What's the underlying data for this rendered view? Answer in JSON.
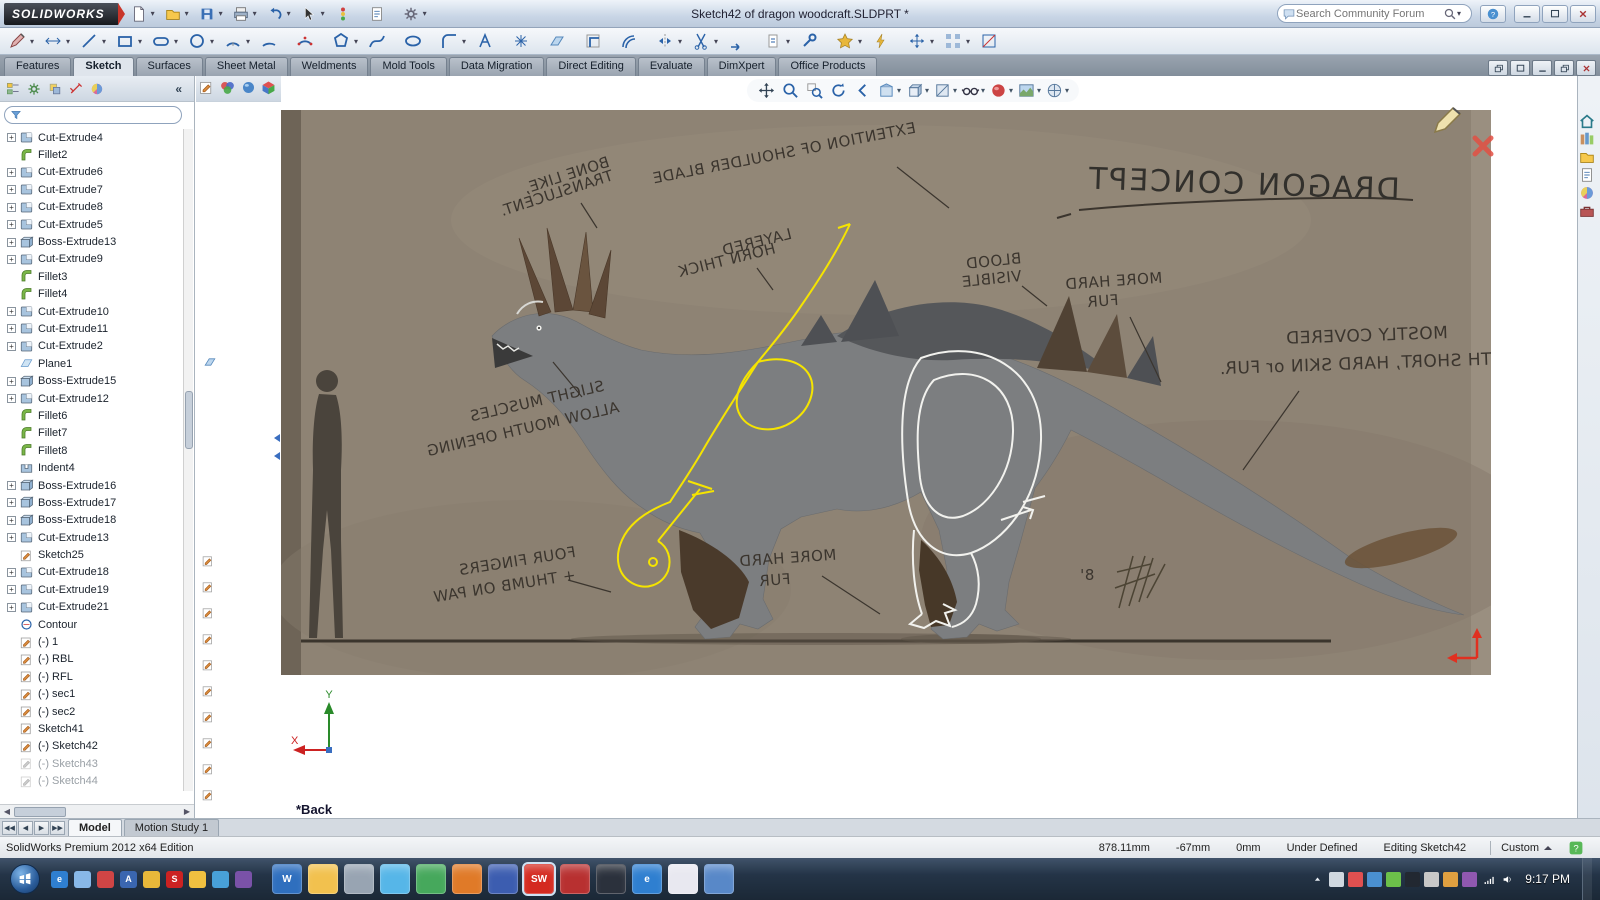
{
  "titlebar": {
    "logo": "SOLIDWORKS",
    "title": "Sketch42 of dragon woodcraft.SLDPRT *",
    "search_placeholder": "Search Community Forum",
    "tools": [
      {
        "icon": "new-doc",
        "n": "new-document",
        "cr": "▾"
      },
      {
        "icon": "open-folder",
        "n": "open-document",
        "cr": "▾"
      },
      {
        "icon": "save",
        "n": "save",
        "cr": "▾"
      },
      {
        "icon": "print",
        "n": "print",
        "cr": "▾"
      },
      {
        "icon": "undo",
        "n": "undo",
        "cr": "▾"
      },
      {
        "icon": "select-cursor",
        "n": "select",
        "cr": "▾"
      },
      {
        "icon": "rebuild",
        "n": "rebuild",
        "cr": ""
      },
      {
        "icon": "file-props",
        "n": "file-properties",
        "cr": ""
      },
      {
        "icon": "options",
        "n": "options",
        "cr": "▾"
      }
    ]
  },
  "sketchbar": [
    {
      "icon": "exit-sketch",
      "n": "sketch",
      "cr": "▾"
    },
    {
      "icon": "smart-dimension",
      "n": "smart-dimension",
      "cr": "▾"
    },
    {
      "icon": "line",
      "n": "line",
      "cr": "▾"
    },
    {
      "icon": "corner-rectangle",
      "n": "corner-rectangle",
      "cr": "▾"
    },
    {
      "icon": "straight-slot",
      "n": "straight-slot",
      "cr": "▾"
    },
    {
      "icon": "circle",
      "n": "circle",
      "cr": "▾"
    },
    {
      "icon": "centerpoint-arc",
      "n": "centerpoint-arc",
      "cr": "▾"
    },
    {
      "icon": "tangent-arc",
      "n": "tangent-arc",
      "cr": ""
    },
    {
      "icon": "3point-arc",
      "n": "three-point-arc",
      "cr": ""
    },
    {
      "icon": "polygon",
      "n": "polygon",
      "cr": "▾"
    },
    {
      "icon": "spline",
      "n": "spline",
      "cr": ""
    },
    {
      "icon": "ellipse",
      "n": "ellipse",
      "cr": ""
    },
    {
      "icon": "sketch-fillet",
      "n": "sketch-fillet",
      "cr": "▾"
    },
    {
      "icon": "text",
      "n": "text",
      "cr": ""
    },
    {
      "icon": "point",
      "n": "point",
      "cr": ""
    },
    {
      "icon": "plane-icon",
      "n": "plane",
      "cr": ""
    },
    {
      "icon": "convert-entities",
      "n": "convert-entities",
      "cr": ""
    },
    {
      "icon": "offset-entities",
      "n": "offset-entities",
      "cr": ""
    },
    {
      "icon": "mirror-entities",
      "n": "mirror-entities",
      "cr": "▾"
    },
    {
      "icon": "trim-entities",
      "n": "trim-entities",
      "cr": "▾"
    },
    {
      "icon": "extend-entities",
      "n": "extend-entities",
      "cr": ""
    },
    {
      "icon": "display-relations",
      "n": "display-delete-relations",
      "cr": "▾"
    },
    {
      "icon": "repair-sketch",
      "n": "repair-sketch",
      "cr": ""
    },
    {
      "icon": "quick-snaps",
      "n": "quick-snaps",
      "cr": "▾"
    },
    {
      "icon": "rapid-sketch",
      "n": "rapid-sketch",
      "cr": ""
    },
    {
      "icon": "move-entities",
      "n": "move-entities",
      "cr": "▾"
    },
    {
      "icon": "linear-pattern",
      "n": "linear-sketch-pattern",
      "cr": "▾"
    },
    {
      "icon": "instant2d",
      "n": "instant2d",
      "cr": ""
    }
  ],
  "cmdtabs": [
    {
      "label": "Features",
      "c": ""
    },
    {
      "label": "Sketch",
      "c": "active"
    },
    {
      "label": "Surfaces",
      "c": ""
    },
    {
      "label": "Sheet Metal",
      "c": ""
    },
    {
      "label": "Weldments",
      "c": ""
    },
    {
      "label": "Mold Tools",
      "c": ""
    },
    {
      "label": "Data Migration",
      "c": ""
    },
    {
      "label": "Direct Editing",
      "c": ""
    },
    {
      "label": "Evaluate",
      "c": ""
    },
    {
      "label": "DimXpert",
      "c": ""
    },
    {
      "label": "Office Products",
      "c": ""
    }
  ],
  "panel": {
    "collapse": "«",
    "tabs": [
      {
        "icon": "feature-tree",
        "n": "featuremanager-tab"
      },
      {
        "icon": "property-manager",
        "n": "propertymanager-tab"
      },
      {
        "icon": "config-manager",
        "n": "configurationmanager-tab"
      },
      {
        "icon": "dimxpert",
        "n": "dimxpertmanager-tab"
      },
      {
        "icon": "display-manager",
        "n": "displaymanager-tab"
      }
    ],
    "tree": [
      {
        "l": "Cut-Extrude4",
        "i": "cut",
        "e": "+",
        "c": ""
      },
      {
        "l": "Fillet2",
        "i": "fillet",
        "e": "",
        "c": ""
      },
      {
        "l": "Cut-Extrude6",
        "i": "cut",
        "e": "+",
        "c": ""
      },
      {
        "l": "Cut-Extrude7",
        "i": "cut",
        "e": "+",
        "c": ""
      },
      {
        "l": "Cut-Extrude8",
        "i": "cut",
        "e": "+",
        "c": ""
      },
      {
        "l": "Cut-Extrude5",
        "i": "cut",
        "e": "+",
        "c": ""
      },
      {
        "l": "Boss-Extrude13",
        "i": "boss",
        "e": "+",
        "c": ""
      },
      {
        "l": "Cut-Extrude9",
        "i": "cut",
        "e": "+",
        "c": ""
      },
      {
        "l": "Fillet3",
        "i": "fillet",
        "e": "",
        "c": ""
      },
      {
        "l": "Fillet4",
        "i": "fillet",
        "e": "",
        "c": ""
      },
      {
        "l": "Cut-Extrude10",
        "i": "cut",
        "e": "+",
        "c": ""
      },
      {
        "l": "Cut-Extrude11",
        "i": "cut",
        "e": "+",
        "c": ""
      },
      {
        "l": "Cut-Extrude2",
        "i": "cut",
        "e": "+",
        "c": ""
      },
      {
        "l": "Plane1",
        "i": "plane",
        "e": "",
        "c": ""
      },
      {
        "l": "Boss-Extrude15",
        "i": "boss",
        "e": "+",
        "c": ""
      },
      {
        "l": "Cut-Extrude12",
        "i": "cut",
        "e": "+",
        "c": ""
      },
      {
        "l": "Fillet6",
        "i": "fillet",
        "e": "",
        "c": ""
      },
      {
        "l": "Fillet7",
        "i": "fillet",
        "e": "",
        "c": ""
      },
      {
        "l": "Fillet8",
        "i": "fillet",
        "e": "",
        "c": ""
      },
      {
        "l": "Indent4",
        "i": "indent",
        "e": "",
        "c": ""
      },
      {
        "l": "Boss-Extrude16",
        "i": "boss",
        "e": "+",
        "c": ""
      },
      {
        "l": "Boss-Extrude17",
        "i": "boss",
        "e": "+",
        "c": ""
      },
      {
        "l": "Boss-Extrude18",
        "i": "boss",
        "e": "+",
        "c": ""
      },
      {
        "l": "Cut-Extrude13",
        "i": "cut",
        "e": "+",
        "c": ""
      },
      {
        "l": "Sketch25",
        "i": "sketch",
        "e": "",
        "c": ""
      },
      {
        "l": "Cut-Extrude18",
        "i": "cut",
        "e": "+",
        "c": ""
      },
      {
        "l": "Cut-Extrude19",
        "i": "cut",
        "e": "+",
        "c": ""
      },
      {
        "l": "Cut-Extrude21",
        "i": "cut",
        "e": "+",
        "c": ""
      },
      {
        "l": "Contour",
        "i": "contour",
        "e": "",
        "c": ""
      },
      {
        "l": "(-) 1",
        "i": "sketch",
        "e": "",
        "c": ""
      },
      {
        "l": "(-) RBL",
        "i": "sketch",
        "e": "",
        "c": ""
      },
      {
        "l": "(-) RFL",
        "i": "sketch",
        "e": "",
        "c": ""
      },
      {
        "l": "(-) sec1",
        "i": "sketch",
        "e": "",
        "c": ""
      },
      {
        "l": "(-) sec2",
        "i": "sketch",
        "e": "",
        "c": ""
      },
      {
        "l": "Sketch41",
        "i": "sketch",
        "e": "",
        "c": ""
      },
      {
        "l": "(-) Sketch42",
        "i": "sketch",
        "e": "",
        "c": ""
      },
      {
        "l": "(-) Sketch43",
        "i": "sketch",
        "e": "",
        "c": "grayed"
      },
      {
        "l": "(-) Sketch44",
        "i": "sketch",
        "e": "",
        "c": "grayed"
      }
    ]
  },
  "flyout_icons": [
    {
      "icon": "sketch-feature",
      "n": "flyout-sketch"
    },
    {
      "icon": "rgb-ball",
      "n": "flyout-appearance"
    },
    {
      "icon": "blue-ball",
      "n": "flyout-scene"
    },
    {
      "icon": "tri-cube",
      "n": "flyout-assembly"
    }
  ],
  "headsup": [
    {
      "icon": "move",
      "n": "pan",
      "cr": ""
    },
    {
      "icon": "zoom-fit",
      "n": "zoom-to-fit",
      "cr": ""
    },
    {
      "icon": "zoom-area",
      "n": "zoom-to-area",
      "cr": ""
    },
    {
      "icon": "rotate-view",
      "n": "rotate-view",
      "cr": ""
    },
    {
      "icon": "previous-view",
      "n": "previous-view",
      "cr": ""
    },
    {
      "icon": "section-view",
      "n": "section-view",
      "cr": "▾"
    },
    {
      "icon": "view-orientation",
      "n": "view-orientation",
      "cr": "▾"
    },
    {
      "icon": "display-style",
      "n": "display-style",
      "cr": "▾"
    },
    {
      "icon": "hide-show",
      "n": "hide-show-items",
      "cr": "▾"
    },
    {
      "icon": "edit-appearance",
      "n": "edit-appearance",
      "cr": "▾"
    },
    {
      "icon": "apply-scene",
      "n": "apply-scene",
      "cr": "▾"
    },
    {
      "icon": "view-settings",
      "n": "view-settings",
      "cr": "▾"
    }
  ],
  "taskpane": [
    {
      "icon": "home",
      "n": "task-pane-home"
    },
    {
      "icon": "design-library",
      "n": "design-library"
    },
    {
      "icon": "open-folder",
      "n": "file-explorer"
    },
    {
      "icon": "custom-props",
      "n": "custom-properties"
    },
    {
      "icon": "display-manager",
      "n": "appearances-scenes"
    },
    {
      "icon": "toolbox",
      "n": "toolbox"
    }
  ],
  "viewport": {
    "plane_label": "*Back",
    "axis_x": "X",
    "axis_y": "Y",
    "ann": {
      "ext": "EXTENTION OF SHOULDER BLADE",
      "bone1": "BONE LIKE,",
      "bone2": "TRANSLUCENT.",
      "horn1": "LAYERED",
      "horn2": "HORN THICK",
      "title": "DRAGON CONCEPT",
      "blood1": "BLOOD",
      "blood2": "VISIBLE",
      "fur1a": "MORE HARD",
      "fur1b": "FUR",
      "mostly1": "MOSTLY COVERED",
      "mostly2": "WITH SHORT, HARD SKIN or FUR.",
      "muscle1": "SLIGHT MUSCLES",
      "muscle2": "ALLOW MOUTH OPENING",
      "fingers1": "FOUR FINGERS",
      "fingers2": "+ THUMB ON PAW",
      "fur2a": "MORE HARD",
      "fur2b": "FUR",
      "scale": "8'"
    }
  },
  "bottombar": {
    "tabs": [
      {
        "label": "Model",
        "c": "active"
      },
      {
        "label": "Motion Study 1",
        "c": ""
      }
    ]
  },
  "statusbar": {
    "edition": "SolidWorks Premium 2012 x64 Edition",
    "x": "878.11mm",
    "y": "-67mm",
    "z": "0mm",
    "state": "Under Defined",
    "editing": "Editing Sketch42",
    "config": "Custom"
  },
  "taskbar": {
    "time": "9:17 PM",
    "quick": [
      {
        "col": "#2f7fd0",
        "t": "e"
      },
      {
        "col": "#88b8e8",
        "t": ""
      },
      {
        "col": "#d04545",
        "t": ""
      },
      {
        "col": "#3a66b0",
        "t": "A"
      },
      {
        "col": "#e8b83a",
        "t": ""
      },
      {
        "col": "#cc2222",
        "t": "S"
      },
      {
        "col": "#f0c040",
        "t": ""
      },
      {
        "col": "#48a0d8",
        "t": ""
      },
      {
        "col": "#7a52a8",
        "t": ""
      }
    ],
    "apps": [
      {
        "col": "#2f6fbe",
        "t": "W",
        "c": ""
      },
      {
        "col": "#f2c14e",
        "t": "",
        "c": ""
      },
      {
        "col": "#98a4b2",
        "t": "",
        "c": ""
      },
      {
        "col": "#56b6e8",
        "t": "",
        "c": ""
      },
      {
        "col": "#46a85c",
        "t": "",
        "c": ""
      },
      {
        "col": "#e07a28",
        "t": "",
        "c": ""
      },
      {
        "col": "#3c5db0",
        "t": "",
        "c": ""
      },
      {
        "col": "#d42a20",
        "t": "SW",
        "c": "active"
      },
      {
        "col": "#b83030",
        "t": "",
        "c": ""
      },
      {
        "col": "#2b313c",
        "t": "",
        "c": ""
      },
      {
        "col": "#2f7fd0",
        "t": "e",
        "c": ""
      },
      {
        "col": "#e8e8f0",
        "t": "",
        "c": ""
      },
      {
        "col": "#5888c8",
        "t": "",
        "c": ""
      }
    ],
    "tray": [
      {
        "col": "#d0d8e0"
      },
      {
        "col": "#e05050"
      },
      {
        "col": "#4a90d0"
      },
      {
        "col": "#6cc04a"
      },
      {
        "col": "#222831"
      },
      {
        "col": "#c8c8c8"
      },
      {
        "col": "#e0a040"
      },
      {
        "col": "#9058b0"
      }
    ]
  }
}
